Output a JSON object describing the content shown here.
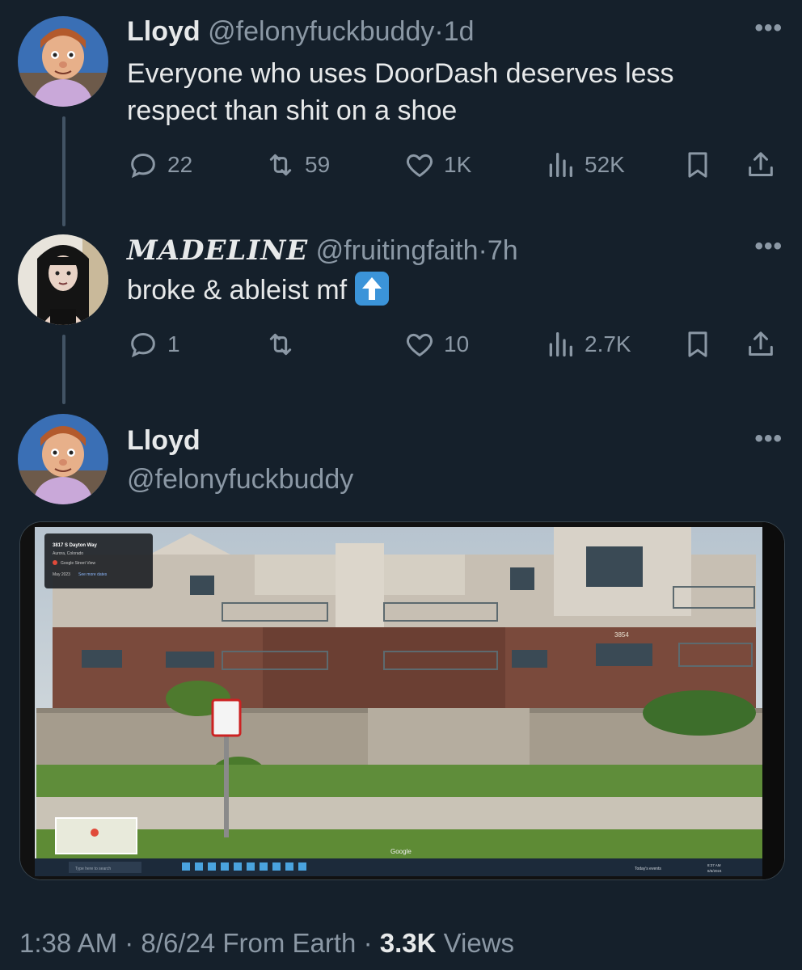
{
  "tweets": [
    {
      "name": "Lloyd",
      "handle": "@felonyfuckbuddy",
      "dot": "·",
      "time": "1d",
      "text": "Everyone who uses DoorDash deserves less respect than shit on a shoe",
      "replies": "22",
      "retweets": "59",
      "likes": "1K",
      "views": "52K"
    },
    {
      "name": "𝓜𝓐𝓓𝓔𝓛𝓘𝓝𝓔",
      "name_plain": "MADELINE",
      "handle": "@fruitingfaith",
      "dot": "·",
      "time": "7h",
      "text": "broke & ableist mf",
      "emoji": "up-arrow-emoji",
      "replies": "1",
      "retweets": "",
      "likes": "10",
      "views": "2.7K"
    }
  ],
  "main": {
    "name": "Lloyd",
    "handle": "@felonyfuckbuddy",
    "image": {
      "address": "3817 S Dayton Way",
      "city": "Aurora, Colorado",
      "source": "Google Street View",
      "date": "May 2023",
      "see_more": "See more dates",
      "building_number": "3854",
      "search_placeholder": "Type here to search",
      "google_mark": "Google",
      "taskbar_weather": "Today's events",
      "clock_time": "8:37 AM",
      "clock_date": "8/6/2024"
    },
    "footer": {
      "time": "1:38 AM",
      "date": "8/6/24",
      "from": "From Earth",
      "dot": "·",
      "views_count": "3.3K",
      "views_label": "Views"
    }
  },
  "icons": {
    "more": "more-dots-icon",
    "reply": "reply-icon",
    "retweet": "retweet-icon",
    "like": "heart-icon",
    "views": "views-bar-chart-icon",
    "bookmark": "bookmark-icon",
    "share": "share-icon"
  },
  "colors": {
    "background": "#15202b",
    "text": "#e7e9ea",
    "muted": "#8b98a5",
    "thread_line": "#425364"
  }
}
